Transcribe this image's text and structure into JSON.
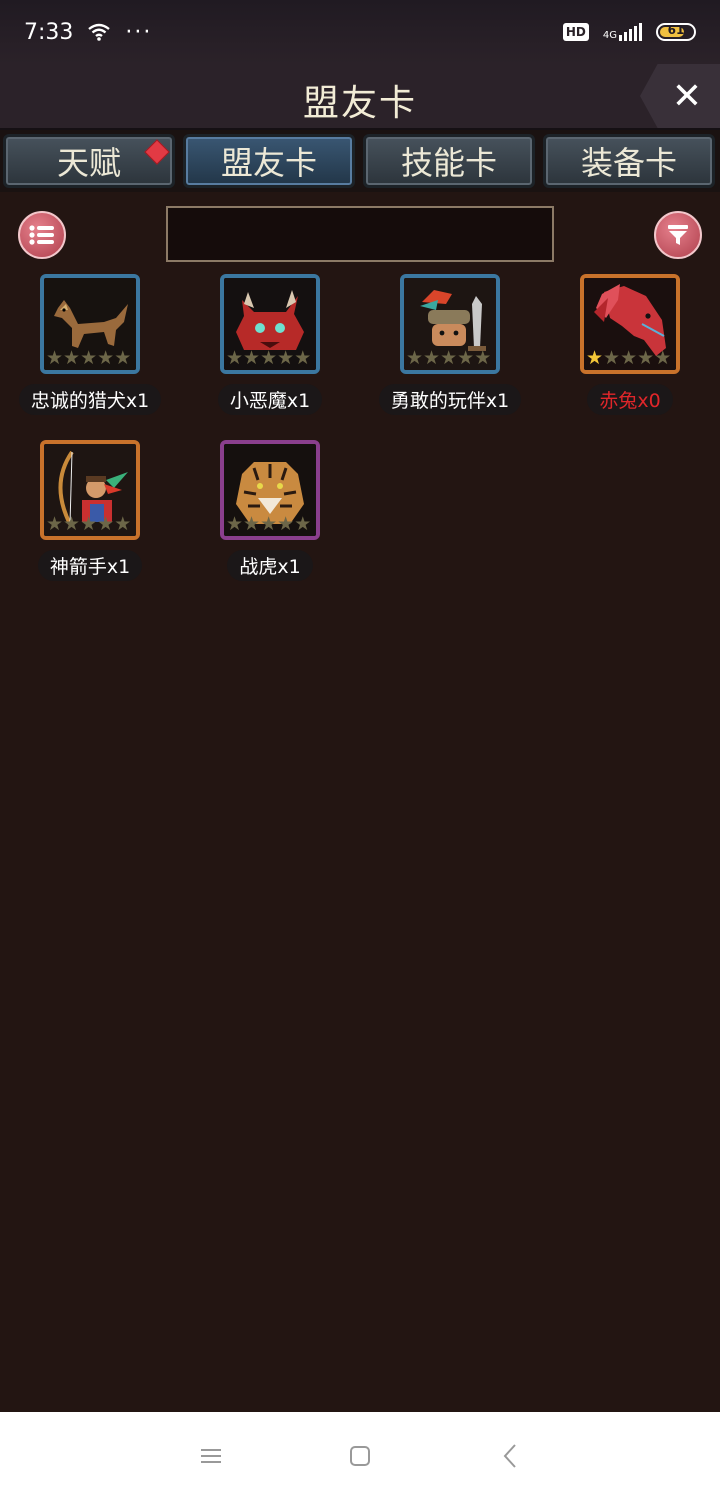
{
  "status_bar": {
    "time": "7:33",
    "hd_label": "HD",
    "network_label": "4G",
    "battery": "61",
    "icons": [
      "wifi-icon",
      "more-dots-icon",
      "signal-icon",
      "battery-icon"
    ]
  },
  "header": {
    "title": "盟友卡",
    "close_icon": "close-icon"
  },
  "tabs": [
    {
      "label": "天赋",
      "active": false,
      "badge": true
    },
    {
      "label": "盟友卡",
      "active": true,
      "badge": false
    },
    {
      "label": "技能卡",
      "active": false,
      "badge": false
    },
    {
      "label": "装备卡",
      "active": false,
      "badge": false
    }
  ],
  "toolbar": {
    "list_icon": "list-icon",
    "filter_icon": "filter-icon",
    "search_value": ""
  },
  "cards": [
    {
      "name": "忠诚的猎犬x1",
      "frame": "blue",
      "stars_lit": 0,
      "portrait": "hound-portrait",
      "owned": true
    },
    {
      "name": "小恶魔x1",
      "frame": "blue",
      "stars_lit": 0,
      "portrait": "imp-portrait",
      "owned": true
    },
    {
      "name": "勇敢的玩伴x1",
      "frame": "blue",
      "stars_lit": 0,
      "portrait": "companion-portrait",
      "owned": true
    },
    {
      "name": "赤兔x0",
      "frame": "gold",
      "stars_lit": 1,
      "portrait": "red-horse-portrait",
      "owned": false
    },
    {
      "name": "神箭手x1",
      "frame": "gold",
      "stars_lit": 0,
      "portrait": "archer-portrait",
      "owned": true
    },
    {
      "name": "战虎x1",
      "frame": "purple",
      "stars_lit": 0,
      "portrait": "tiger-portrait",
      "owned": true
    }
  ],
  "colors": {
    "background": "#231512",
    "blue_frame": "#3b77a0",
    "gold_frame": "#c8722b",
    "purple_frame": "#8a3f8d",
    "unowned_text": "#e0262a",
    "star_lit": "#f4c738"
  },
  "nav_bar": {
    "icons": [
      "menu-icon",
      "home-icon",
      "back-icon"
    ]
  }
}
